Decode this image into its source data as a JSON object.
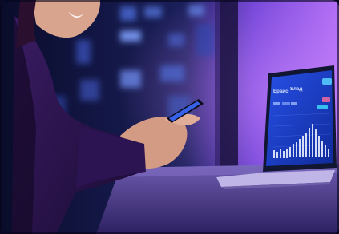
{
  "scene": {
    "description_type": "photo",
    "palette": {
      "background_dark": "#0b0a26",
      "purple_glow": "#a55bf2",
      "window_blue": "#2a3c8a",
      "desk": "#5a4a8f",
      "jacket": "#2a1347",
      "skin": "#d79f8a",
      "screen_blue": "#1d4fe3"
    }
  },
  "laptop_screen": {
    "brand_left": "Ераис",
    "brand_right": "Ѕлад"
  }
}
